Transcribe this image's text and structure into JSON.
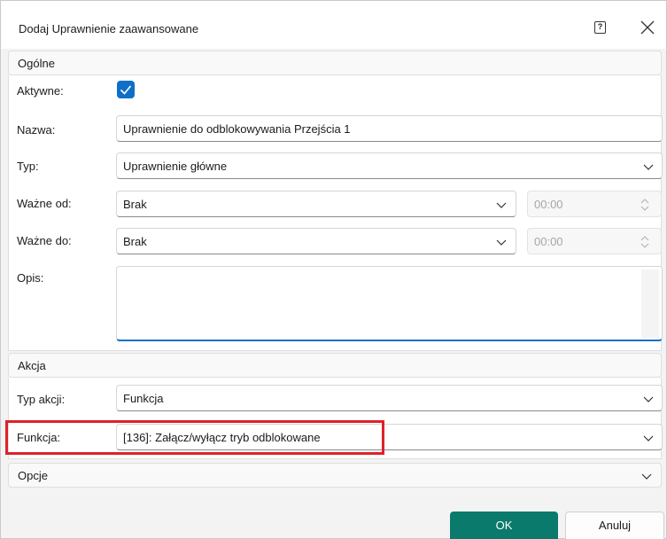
{
  "window": {
    "title": "Dodaj Uprawnienie zaawansowane",
    "help_glyph": "?"
  },
  "general": {
    "header": "Ogólne",
    "active_label": "Aktywne:",
    "active_checked": true,
    "name_label": "Nazwa:",
    "name_value": "Uprawnienie do odblokowywania Przejścia 1",
    "type_label": "Typ:",
    "type_value": "Uprawnienie główne",
    "valid_from_label": "Ważne od:",
    "valid_from_value": "Brak",
    "valid_from_time": "00:00",
    "valid_to_label": "Ważne do:",
    "valid_to_value": "Brak",
    "valid_to_time": "00:00",
    "description_label": "Opis:",
    "description_value": ""
  },
  "action": {
    "header": "Akcja",
    "action_type_label": "Typ akcji:",
    "action_type_value": "Funkcja",
    "function_label": "Funkcja:",
    "function_value": "[136]: Załącz/wyłącz tryb odblokowane"
  },
  "options": {
    "header": "Opcje"
  },
  "buttons": {
    "ok": "OK",
    "cancel": "Anuluj"
  },
  "colors": {
    "accent": "#0f6fc8",
    "ok_button": "#0a7a6c",
    "highlight": "#e0202a"
  }
}
